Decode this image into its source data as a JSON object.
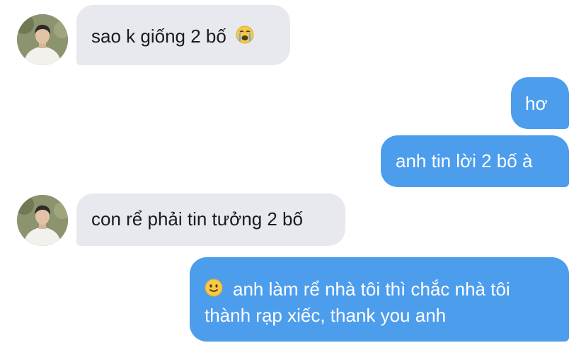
{
  "messages": [
    {
      "from": "them",
      "text": "sao k giống 2 bố",
      "emoji": "loudly-crying-face"
    },
    {
      "from": "me",
      "text": "hơ"
    },
    {
      "from": "me",
      "text": "anh tin lời 2 bố à"
    },
    {
      "from": "them",
      "text": "con rể phải tin tưởng 2 bố"
    },
    {
      "from": "me",
      "emoji": "slightly-smiling-face",
      "line1": "anh làm rể nhà tôi thì chắc nhà tôi",
      "line2": "thành rạp xiếc, thank you anh"
    }
  ],
  "colors": {
    "incoming_bubble": "#e7e9ee",
    "outgoing_bubble": "#4d9ded",
    "incoming_text": "#1b1b1b",
    "outgoing_text": "#ffffff"
  }
}
